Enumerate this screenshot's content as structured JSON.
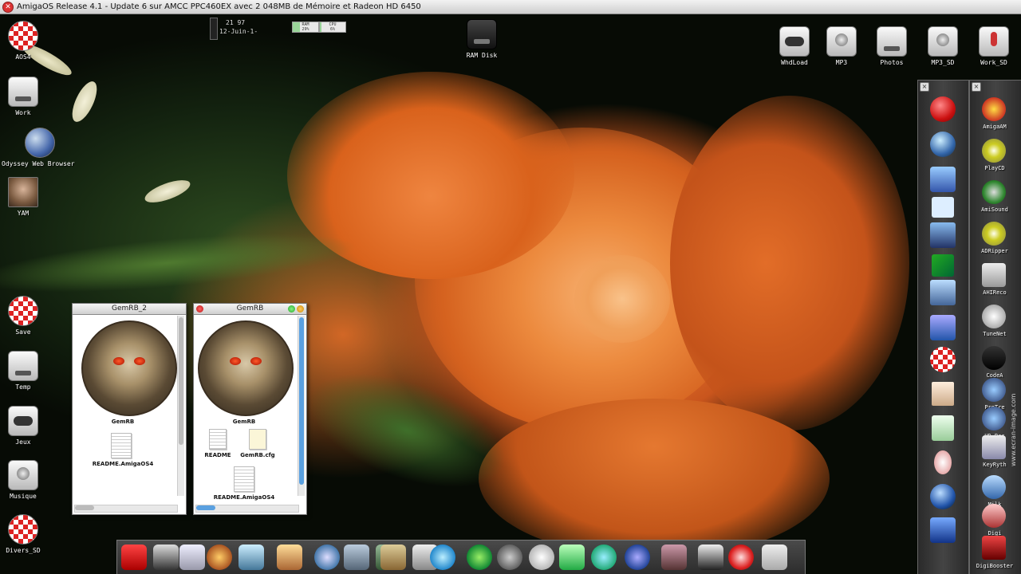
{
  "titlebar": {
    "title": "AmigaOS Release 4.1 - Update 6 sur AMCC PPC460EX avec 2 048MB de Mémoire et Radeon HD 6450"
  },
  "clock": {
    "time": "21 97",
    "date": "12-Juin-1-"
  },
  "meters": {
    "ram_label": "RAM",
    "ram_value": "29%",
    "ram_level": 0.29,
    "cpu_label": "CPU",
    "cpu_value": "6%",
    "cpu_level": 0.06
  },
  "left_icons": [
    {
      "label": "AOS4"
    },
    {
      "label": "Work"
    },
    {
      "label": "Odyssey Web Browser"
    },
    {
      "label": "YAM"
    },
    {
      "label": "Save"
    },
    {
      "label": "Temp"
    },
    {
      "label": "Jeux"
    },
    {
      "label": "Musique"
    },
    {
      "label": "Divers_SD"
    }
  ],
  "ramdisk": {
    "label": "RAM Disk"
  },
  "top_right_icons": [
    {
      "label": "WhdLoad"
    },
    {
      "label": "MP3"
    },
    {
      "label": "Photos"
    },
    {
      "label": "MP3_SD"
    },
    {
      "label": "Work_SD"
    }
  ],
  "window1": {
    "title": "GemRB_2",
    "items": [
      "GemRB",
      "README.AmigaOS4"
    ]
  },
  "window2": {
    "title": "GemRB",
    "items": [
      "GemRB",
      "README",
      "GemRB.cfg",
      "README.AmigaOS4"
    ]
  },
  "right_dock": {
    "labels": [
      "AmigaAM",
      "PlayCD",
      "AmiSound",
      "ADRipper",
      "AHIReco",
      "TuneNet",
      "CodeA",
      "ProTre",
      "HD-Rec",
      "KeyRyth",
      "Milk",
      "Digi",
      "DigiBooster"
    ]
  },
  "mid_dock": {
    "items": [
      "power",
      "eject",
      "drive",
      "close-window",
      "amiga",
      "network",
      "monitor",
      "delta",
      "amiga-ball",
      "archive",
      "calculator",
      "sound",
      "apple",
      "drive-blue"
    ]
  },
  "bottom_dock": {
    "items": [
      "YouTube",
      "MPlayer",
      "browser",
      "MPlayer",
      "shell",
      "GiMe",
      "shell",
      "archive",
      "screen",
      "download",
      "edit",
      "refresh",
      "pdf",
      "record",
      "cd",
      "shift",
      "cycle",
      "globe",
      "photo",
      "UAE",
      "sun",
      "drive"
    ]
  },
  "watermark": {
    "text": "www.ecran-image.com"
  }
}
